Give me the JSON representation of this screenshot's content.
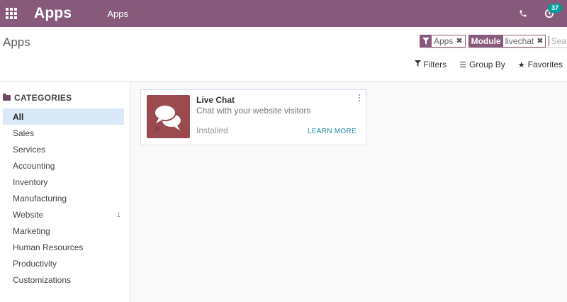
{
  "navbar": {
    "brand": "Apps",
    "menu": "Apps",
    "activity_count": "37",
    "icons": [
      "apps-grid-icon",
      "phone-icon",
      "clock-icon"
    ],
    "color": "#875a7b"
  },
  "control_panel": {
    "title": "Apps",
    "search": {
      "facets": [
        {
          "tag_icon": "filter-icon",
          "value": "Apps"
        },
        {
          "tag": "Module",
          "value": "livechat"
        }
      ],
      "placeholder": "Search..."
    },
    "options": {
      "filters": "Filters",
      "group_by": "Group By",
      "favorites": "Favorites"
    }
  },
  "sidebar": {
    "header": "CATEGORIES",
    "items": [
      {
        "label": "All",
        "count": ""
      },
      {
        "label": "Sales",
        "count": ""
      },
      {
        "label": "Services",
        "count": ""
      },
      {
        "label": "Accounting",
        "count": ""
      },
      {
        "label": "Inventory",
        "count": ""
      },
      {
        "label": "Manufacturing",
        "count": ""
      },
      {
        "label": "Website",
        "count": "1"
      },
      {
        "label": "Marketing",
        "count": ""
      },
      {
        "label": "Human Resources",
        "count": ""
      },
      {
        "label": "Productivity",
        "count": ""
      },
      {
        "label": "Customizations",
        "count": ""
      }
    ],
    "active_item": "All"
  },
  "kanban": {
    "card": {
      "title": "Live Chat",
      "description": "Chat with your website visitors",
      "status": "Installed",
      "action": "LEARN MORE",
      "icon": "chat-bubbles-icon",
      "icon_color": "#9b4a4f"
    }
  }
}
